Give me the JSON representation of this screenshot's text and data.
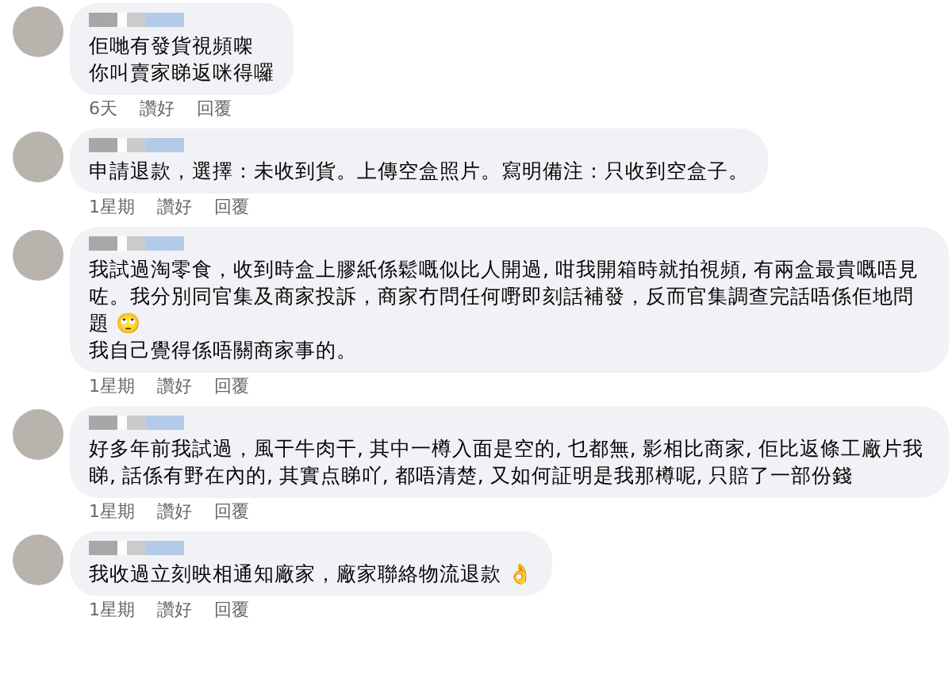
{
  "comments": [
    {
      "lines": [
        "佢哋有發貨視頻㗎",
        "你叫賣家睇返咪得囉"
      ],
      "time": "6天",
      "like": "讚好",
      "reply": "回覆"
    },
    {
      "lines": [
        "申請退款，選擇：未收到貨。上傳空盒照片。寫明備注：只收到空盒子。"
      ],
      "time": "1星期",
      "like": "讚好",
      "reply": "回覆"
    },
    {
      "lines": [
        "我試過淘零食，收到時盒上膠紙係鬆嘅似比人開過, 咁我開箱時就拍視頻, 有兩盒最貴嘅唔見咗。我分別同官集及商家投訴，商家冇問任何嘢即刻話補發，反而官集調查完話唔係佢地問題 🙄",
        "我自己覺得係唔關商家事的。"
      ],
      "time": "1星期",
      "like": "讚好",
      "reply": "回覆"
    },
    {
      "lines": [
        "好多年前我試過，風干牛肉干, 其中一樽入面是空的, 乜都無, 影相比商家, 佢比返條工廠片我睇, 話係有野在內的, 其實点睇吖, 都唔清楚, 又如何証明是我那樽呢, 只賠了一部份錢"
      ],
      "time": "1星期",
      "like": "讚好",
      "reply": "回覆"
    },
    {
      "lines": [
        "我收過立刻映相通知廠家，廠家聯絡物流退款 👌"
      ],
      "time": "1星期",
      "like": "讚好",
      "reply": "回覆"
    }
  ]
}
